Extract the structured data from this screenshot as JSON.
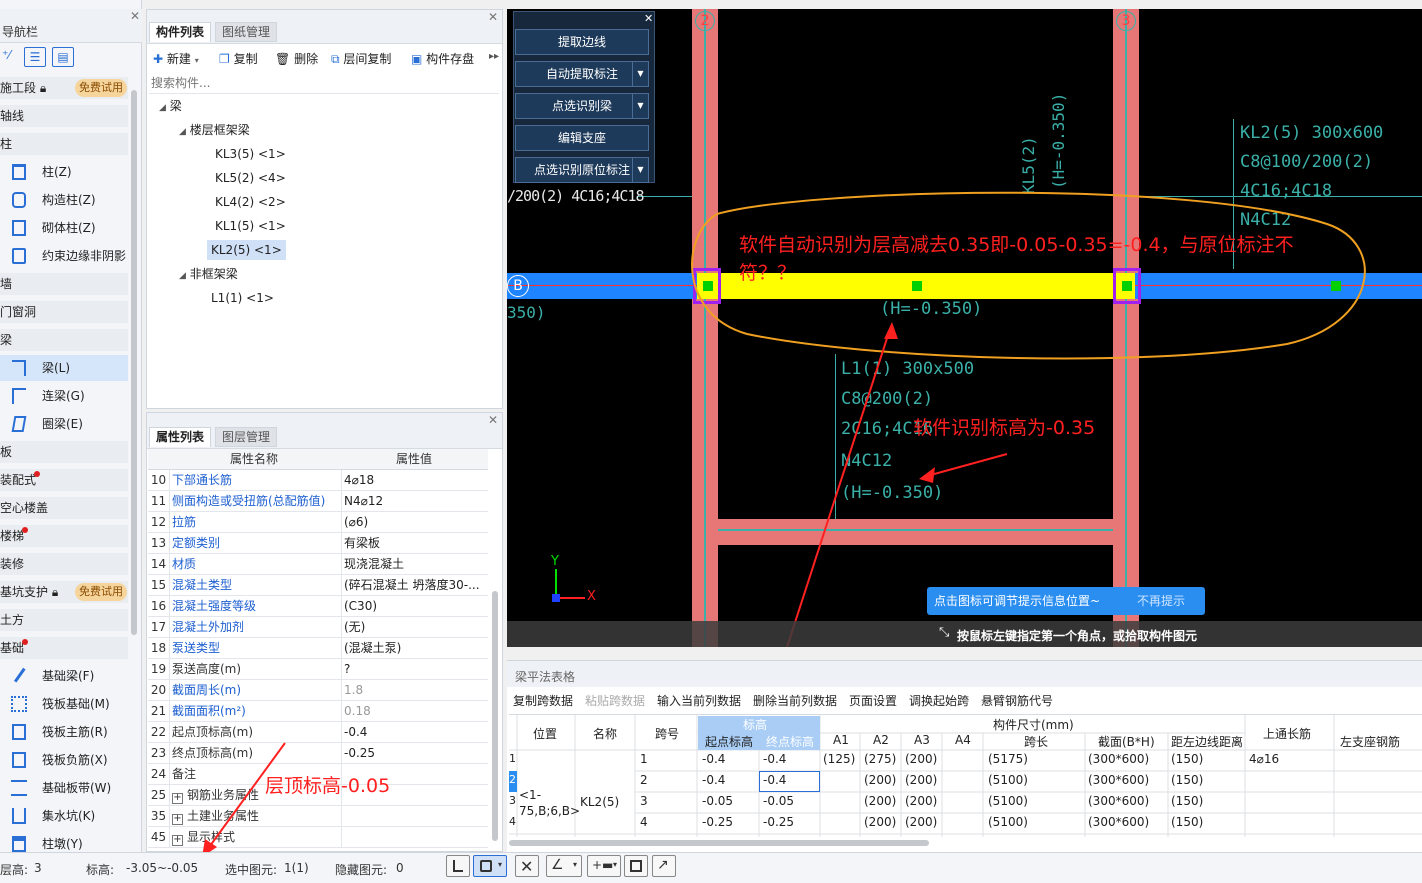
{
  "nav": {
    "title": "导航栏",
    "sections": [
      {
        "label": "施工段",
        "badge": "免费试用"
      },
      {
        "label": "轴线"
      },
      {
        "label": "柱"
      },
      {
        "label": "墙"
      },
      {
        "label": "门窗洞"
      },
      {
        "label": "梁"
      },
      {
        "label": "板"
      },
      {
        "label": "装配式"
      },
      {
        "label": "空心楼盖"
      },
      {
        "label": "楼梯"
      },
      {
        "label": "装修"
      },
      {
        "label": "基坑支护",
        "badge": "免费试用"
      },
      {
        "label": "土方"
      },
      {
        "label": "基础"
      }
    ],
    "items": [
      {
        "label": "柱(Z)"
      },
      {
        "label": "构造柱(Z)"
      },
      {
        "label": "砌体柱(Z)"
      },
      {
        "label": "约束边缘非阴影"
      },
      {
        "label": "梁(L)"
      },
      {
        "label": "连梁(G)"
      },
      {
        "label": "圈梁(E)"
      },
      {
        "label": "基础梁(F)"
      },
      {
        "label": "筏板基础(M)"
      },
      {
        "label": "筏板主筋(R)"
      },
      {
        "label": "筏板负筋(X)"
      },
      {
        "label": "基础板带(W)"
      },
      {
        "label": "集水坑(K)"
      },
      {
        "label": "柱墩(Y)"
      }
    ]
  },
  "component_panel": {
    "tabs": [
      "构件列表",
      "图纸管理"
    ],
    "toolbar": [
      "新建",
      "复制",
      "删除",
      "层间复制",
      "构件存盘"
    ],
    "search_placeholder": "搜索构件...",
    "tree": {
      "root": "梁",
      "group1": "楼层框架梁",
      "items1": [
        "KL3(5) <1>",
        "KL5(2) <4>",
        "KL4(2) <2>",
        "KL1(5) <1>",
        "KL2(5) <1>"
      ],
      "group2": "非框架梁",
      "items2": [
        "L1(1) <1>"
      ]
    }
  },
  "property_panel": {
    "tabs": [
      "属性列表",
      "图层管理"
    ],
    "col_name": "属性名称",
    "col_value": "属性值",
    "rows": [
      {
        "no": "10",
        "name": "下部通长筋",
        "value": "4⌀18"
      },
      {
        "no": "11",
        "name": "侧面构造或受扭筋(总配筋值)",
        "value": "N4⌀12"
      },
      {
        "no": "12",
        "name": "拉筋",
        "value": "(⌀6)"
      },
      {
        "no": "13",
        "name": "定额类别",
        "value": "有梁板"
      },
      {
        "no": "14",
        "name": "材质",
        "value": "现浇混凝土"
      },
      {
        "no": "15",
        "name": "混凝土类型",
        "value": "(碎石混凝土 坍落度30-..."
      },
      {
        "no": "16",
        "name": "混凝土强度等级",
        "value": "(C30)"
      },
      {
        "no": "17",
        "name": "混凝土外加剂",
        "value": "(无)"
      },
      {
        "no": "18",
        "name": "泵送类型",
        "value": "(混凝土泵)"
      },
      {
        "no": "19",
        "name": "泵送高度(m)",
        "value": "?"
      },
      {
        "no": "20",
        "name": "截面周长(m)",
        "value": "1.8"
      },
      {
        "no": "21",
        "name": "截面面积(m²)",
        "value": "0.18"
      },
      {
        "no": "22",
        "name": "起点顶标高(m)",
        "value": "-0.4"
      },
      {
        "no": "23",
        "name": "终点顶标高(m)",
        "value": "-0.25"
      },
      {
        "no": "24",
        "name": "备注",
        "value": ""
      },
      {
        "no": "25",
        "name": "钢筋业务属性",
        "value": ""
      },
      {
        "no": "35",
        "name": "土建业务属性",
        "value": ""
      },
      {
        "no": "45",
        "name": "显示样式",
        "value": ""
      }
    ]
  },
  "cad": {
    "buttons": [
      "提取边线",
      "自动提取标注",
      "点选识别梁",
      "编辑支座",
      "点选识别原位标注"
    ],
    "axis_2": "2",
    "axis_3": "3",
    "axis_b": "B",
    "text_left": "/200(2) 4C16;4C18",
    "text_kl5_1": "KL5(2)",
    "text_kl5_2": "(H=-0.350)",
    "text_kl2": [
      "KL2(5) 300x600",
      "C8@100/200(2)",
      "4C16;4C18",
      "N4C12"
    ],
    "text_h_beam": "(H=-0.350)",
    "text_350": "350)",
    "text_l1": [
      "L1(1) 300x500",
      "C8@200(2)",
      "2C16;4C16",
      "N4C12",
      "(H=-0.350)"
    ],
    "tip_text": "点击图标可调节提示信息位置~",
    "tip_dismiss": "不再提示",
    "status_hint": "按鼠标左键指定第一个角点，或拾取构件图元",
    "axis_x": "X",
    "axis_y": "Y"
  },
  "annotations": {
    "a1": "软件自动识别为层高减去0.35即-0.05-0.35=-0.4，与原位标注不符？？",
    "a2": "软件识别标高为-0.35",
    "a3": "层顶标高-0.05"
  },
  "grid_panel": {
    "title": "梁平法表格",
    "toolbar": [
      "复制跨数据",
      "粘贴跨数据",
      "输入当前列数据",
      "删除当前列数据",
      "页面设置",
      "调换起始跨",
      "悬臂钢筋代号"
    ],
    "headers": {
      "pos": "位置",
      "name": "名称",
      "span": "跨号",
      "elev": "标高",
      "start": "起点标高",
      "end": "终点标高",
      "dims": "构件尺寸(mm)",
      "a1": "A1",
      "a2": "A2",
      "a3": "A3",
      "a4": "A4",
      "spanlen": "跨长",
      "section": "截面(B*H)",
      "edge": "距左边线距离",
      "top": "上通长筋",
      "left_seat": "左支座钢筋"
    },
    "pos_value": "<1-75,B;6,B>",
    "name_value": "KL2(5)",
    "rownums": [
      "1",
      "2",
      "3",
      "4"
    ],
    "rows": [
      {
        "span": "1",
        "start": "-0.4",
        "end": "-0.4",
        "a1": "(125)",
        "a2": "(275)",
        "a3": "(200)",
        "len": "(5175)",
        "sec": "(300*600)",
        "edge": "(150)",
        "top": "4⌀16"
      },
      {
        "span": "2",
        "start": "-0.4",
        "end": "-0.4",
        "a1": "",
        "a2": "(200)",
        "a3": "(200)",
        "len": "(5100)",
        "sec": "(300*600)",
        "edge": "(150)",
        "top": ""
      },
      {
        "span": "3",
        "start": "-0.05",
        "end": "-0.05",
        "a1": "",
        "a2": "(200)",
        "a3": "(200)",
        "len": "(5100)",
        "sec": "(300*600)",
        "edge": "(150)",
        "top": ""
      },
      {
        "span": "4",
        "start": "-0.25",
        "end": "-0.25",
        "a1": "",
        "a2": "(200)",
        "a3": "(200)",
        "len": "(5100)",
        "sec": "(300*600)",
        "edge": "(150)",
        "top": ""
      }
    ]
  },
  "status": {
    "floor_label": "层高:",
    "floor_value": "3",
    "elev_label": "标高:",
    "elev_value": "-3.05~-0.05",
    "sel_label": "选中图元:",
    "sel_value": "1(1)",
    "hidden_label": "隐藏图元:",
    "hidden_value": "0"
  },
  "colors": {
    "annotation_red": "#ff2020",
    "beam_yellow": "#ffff00",
    "highlight_orange": "#f0a020",
    "column_pink": "#e77777",
    "cad_cyan": "#3ab0a8"
  }
}
